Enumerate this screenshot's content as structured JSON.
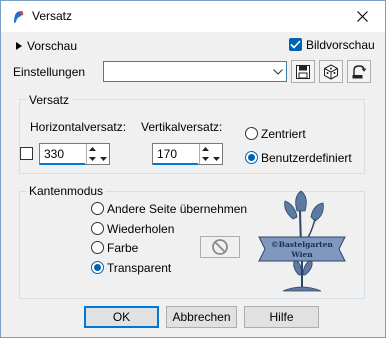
{
  "window": {
    "title": "Versatz",
    "app_icon": "paintshop-icon",
    "close_icon": "close-icon"
  },
  "header": {
    "preview_toggle_label": "Vorschau",
    "image_preview_label": "Bildvorschau",
    "image_preview_checked": true
  },
  "settings": {
    "label": "Einstellungen",
    "value": "",
    "save_icon": "floppy-save-icon",
    "randomize_icon": "dice-icon",
    "reset_icon": "reset-icon"
  },
  "offset_group": {
    "legend": "Versatz",
    "horizontal_label": "Horizontalversatz:",
    "horizontal_value": "330",
    "vertical_label": "Vertikalversatz:",
    "vertical_value": "170",
    "link_checked": false,
    "centered_label": "Zentriert",
    "custom_label": "Benutzerdefiniert",
    "selected": "custom"
  },
  "edge_group": {
    "legend": "Kantenmodus",
    "options": [
      {
        "label": "Andere Seite übernehmen",
        "selected": false
      },
      {
        "label": "Wiederholen",
        "selected": false
      },
      {
        "label": "Farbe",
        "selected": false
      },
      {
        "label": "Transparent",
        "selected": true
      }
    ],
    "color_swatch_icon": "no-color-icon"
  },
  "watermark": {
    "line1": "©Bastelgarten",
    "line2": "Wien"
  },
  "buttons": {
    "ok": "OK",
    "cancel": "Abbrechen",
    "help": "Hilfe"
  },
  "colors": {
    "accent": "#0078d7",
    "check": "#0063b1",
    "dialog_bg": "#f0f0f0"
  }
}
